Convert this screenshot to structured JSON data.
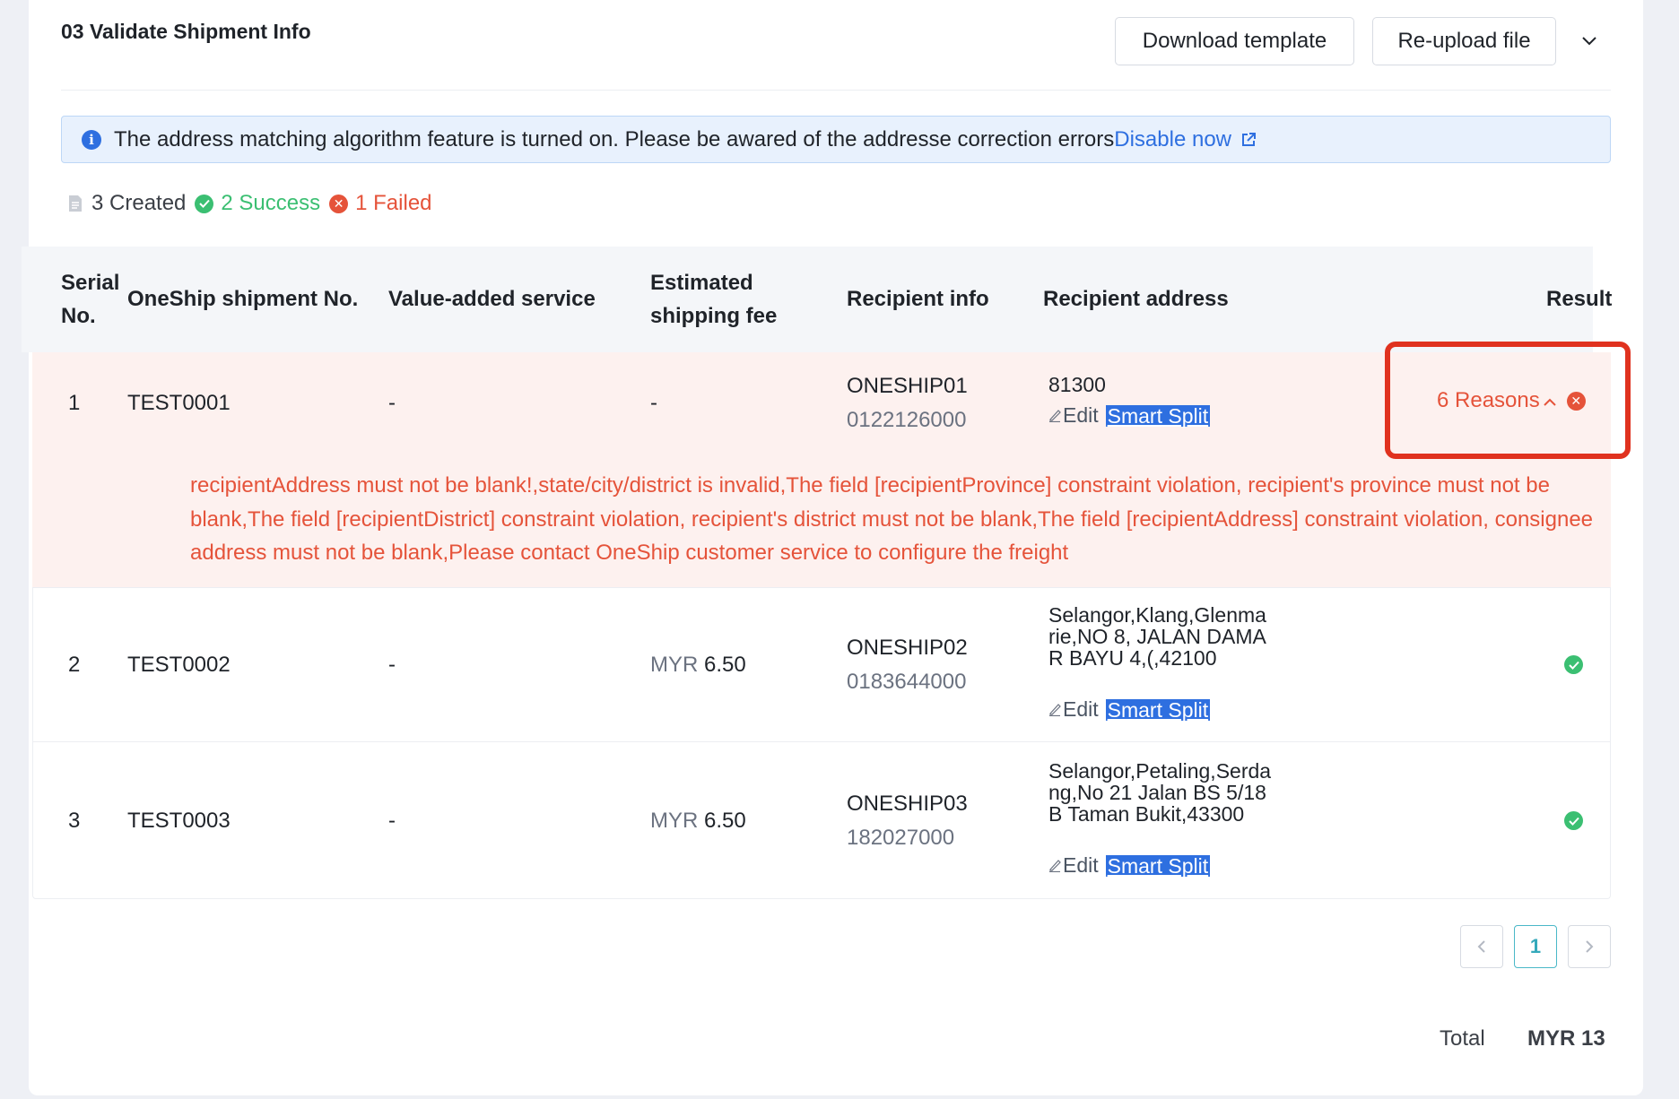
{
  "section": {
    "title": "03 Validate Shipment Info",
    "download_label": "Download template",
    "reupload_label": "Re-upload file",
    "collapse_icon": "chevron-down-icon"
  },
  "notice": {
    "text": "The address matching algorithm feature is turned on. Please be awared of the addresse correction errors",
    "link": "Disable now",
    "icon": "info-icon"
  },
  "stats": {
    "created": "3 Created",
    "success": "2 Success",
    "failed": "1 Failed"
  },
  "table": {
    "headers": {
      "serial_line1": "Serial",
      "serial_line2": "No.",
      "shipment_no": "OneShip shipment No.",
      "vas": "Value-added service",
      "fee_line1": "Estimated",
      "fee_line2": "shipping fee",
      "recipient_info": "Recipient info",
      "recipient_address": "Recipient address",
      "result": "Result"
    },
    "rows": [
      {
        "serial": "1",
        "shipment_no": "TEST0001",
        "vas": "-",
        "fee": "-",
        "name": "ONESHIP01",
        "phone": "0122126000",
        "address": "81300",
        "edit": "Edit",
        "smart_split": "Smart Split",
        "result": "6 Reasons",
        "status": "failed",
        "error_message": "recipientAddress must not be blank!,state/city/district is invalid,The field [recipientProvince] constraint violation, recipient's province must not be blank,The field [recipientDistrict] constraint violation, recipient's district must not be blank,The field [recipientAddress] constraint violation, consignee address must not be blank,Please contact OneShip customer service to configure the freight"
      },
      {
        "serial": "2",
        "shipment_no": "TEST0002",
        "vas": "-",
        "fee_currency": "MYR",
        "fee_amount": "6.50",
        "name": "ONESHIP02",
        "phone": "0183644000",
        "address": "Selangor,Klang,Glenmarie,NO 8, JALAN DAMAR BAYU 4,(,42100",
        "edit": "Edit",
        "smart_split": "Smart Split",
        "status": "success"
      },
      {
        "serial": "3",
        "shipment_no": "TEST0003",
        "vas": "-",
        "fee_currency": "MYR",
        "fee_amount": "6.50",
        "name": "ONESHIP03",
        "phone": "182027000",
        "address": "Selangor,Petaling,Serdang,No 21 Jalan BS 5/18B Taman Bukit,43300",
        "edit": "Edit",
        "smart_split": "Smart Split",
        "status": "success"
      }
    ]
  },
  "pagination": {
    "current_page": "1",
    "prev_icon": "chevron-left-icon",
    "next_icon": "chevron-right-icon"
  },
  "total": {
    "label": "Total",
    "value": "MYR 13"
  },
  "colors": {
    "error": "#e5533a",
    "success": "#3bbf72",
    "link": "#2e6fe0",
    "highlight": "#e0321f"
  }
}
